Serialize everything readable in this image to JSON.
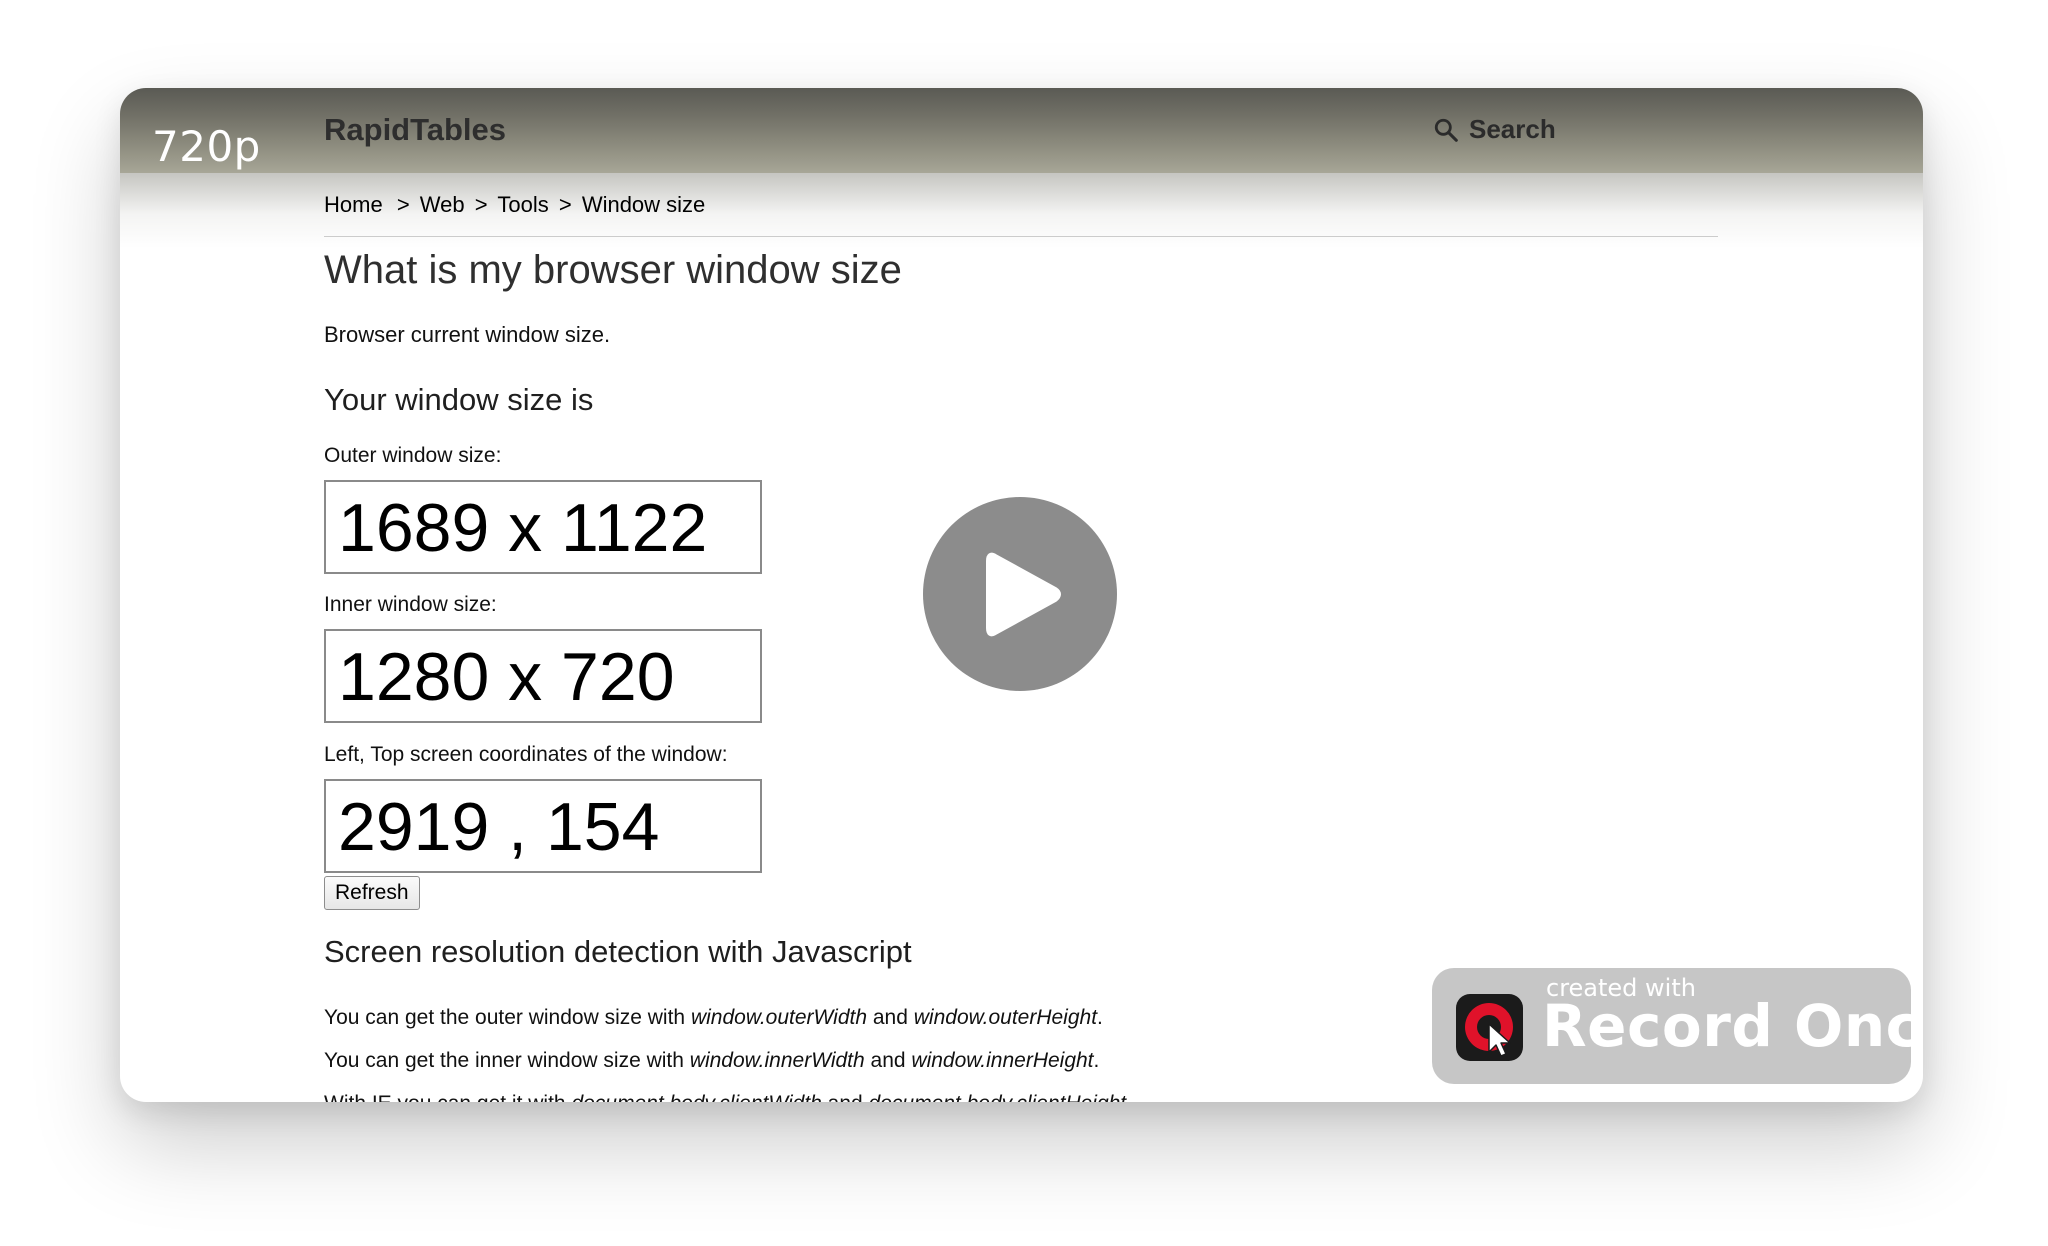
{
  "player": {
    "quality_label": "720p"
  },
  "site": {
    "brand": "RapidTables",
    "search_label": "Search"
  },
  "breadcrumb": {
    "items": [
      "Home",
      "Web",
      "Tools",
      "Window size"
    ],
    "separator": ">"
  },
  "page": {
    "title": "What is my browser window size",
    "intro": "Browser current window size.",
    "section_heading": "Your window size is",
    "outer_label": "Outer window size:",
    "outer_value": "1689 x 1122",
    "inner_label": "Inner window size:",
    "inner_value": "1280 x 720",
    "coords_label": "Left, Top screen coordinates of the window:",
    "coords_value": "2919 , 154",
    "refresh_label": "Refresh",
    "section2_heading": "Screen resolution detection with Javascript",
    "lines": [
      {
        "prefix": "You can get the outer window size with ",
        "code1": "window.outerWidth",
        "mid": " and ",
        "code2": "window.outerHeight",
        "suffix": "."
      },
      {
        "prefix": "You can get the inner window size with ",
        "code1": "window.innerWidth",
        "mid": " and ",
        "code2": "window.innerHeight",
        "suffix": "."
      },
      {
        "prefix": "With IE you can get it with ",
        "code1": "document.body.clientWidth",
        "mid": " and ",
        "code2": "document.body.clientHeight",
        "suffix": "."
      }
    ]
  },
  "watermark": {
    "small_text": "created with",
    "big_text": "Record Once"
  },
  "colors": {
    "header_dark": "#5a5a54",
    "header_light": "#a7a697",
    "play_button": "#8c8c8c",
    "watermark_bg": "#bebebe",
    "logo_red": "#e0122a"
  },
  "icons": {
    "search": "magnifier-icon",
    "play": "play-icon",
    "logo": "record-once-logo-icon"
  }
}
